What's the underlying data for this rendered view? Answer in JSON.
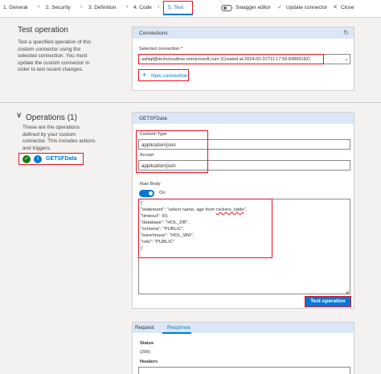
{
  "nav": {
    "steps": [
      "1. General",
      "2. Security",
      "3. Definition",
      "4. Code",
      "5. Test"
    ],
    "separator": "›",
    "swagger_label": "Swagger editor",
    "update_label": "Update connector",
    "close_label": "Close"
  },
  "test_operation": {
    "title": "Test operation",
    "description": [
      "Test a specified operation of this",
      "custom connector using the",
      "selected connection. You must",
      "update the custom connector in",
      "order to test recent changes."
    ]
  },
  "connections": {
    "header": "Connections",
    "selected_label": "Selected connection *",
    "selected_value": "ashiqf@techcloudtree.onmicrosoft.com (Created at 2024-03-31T11:17:59.8389918Z)",
    "new_connection_label": "New connection"
  },
  "operations": {
    "title": "Operations (1)",
    "description": [
      "These are the operations",
      "defined by your custom",
      "connector. This includes actions",
      "and triggers."
    ],
    "items": [
      {
        "name": "GETSFData"
      }
    ]
  },
  "operation_panel": {
    "header": "GETSFData",
    "content_type_label": "Content-Type",
    "content_type_value": "application/json",
    "accept_label": "Accept",
    "accept_value": "application/json",
    "raw_body_label": "Raw Body",
    "raw_body_toggle": "On",
    "body_lines": [
      "{",
      "\"statement\": \"select name, age from ",
      "\"timeout\": 60,",
      "\"database\": \"HOL_DB\",",
      "\"schema\": \"PUBLIC\",",
      "\"warehouse\": \"HOL_WH\",",
      "\"role\": \"PUBLIC\"",
      "}"
    ],
    "body_squiggle_part": "rockers_table",
    "body_line1_end": "\",",
    "test_button": "Test operation"
  },
  "response_area": {
    "tabs": [
      "Request",
      "Response"
    ],
    "status_label": "Status",
    "status_value": "(200)",
    "headers_label": "Headers"
  },
  "colors": {
    "accent": "#0078d4",
    "highlight_red": "#e81123",
    "success": "#107c10"
  }
}
